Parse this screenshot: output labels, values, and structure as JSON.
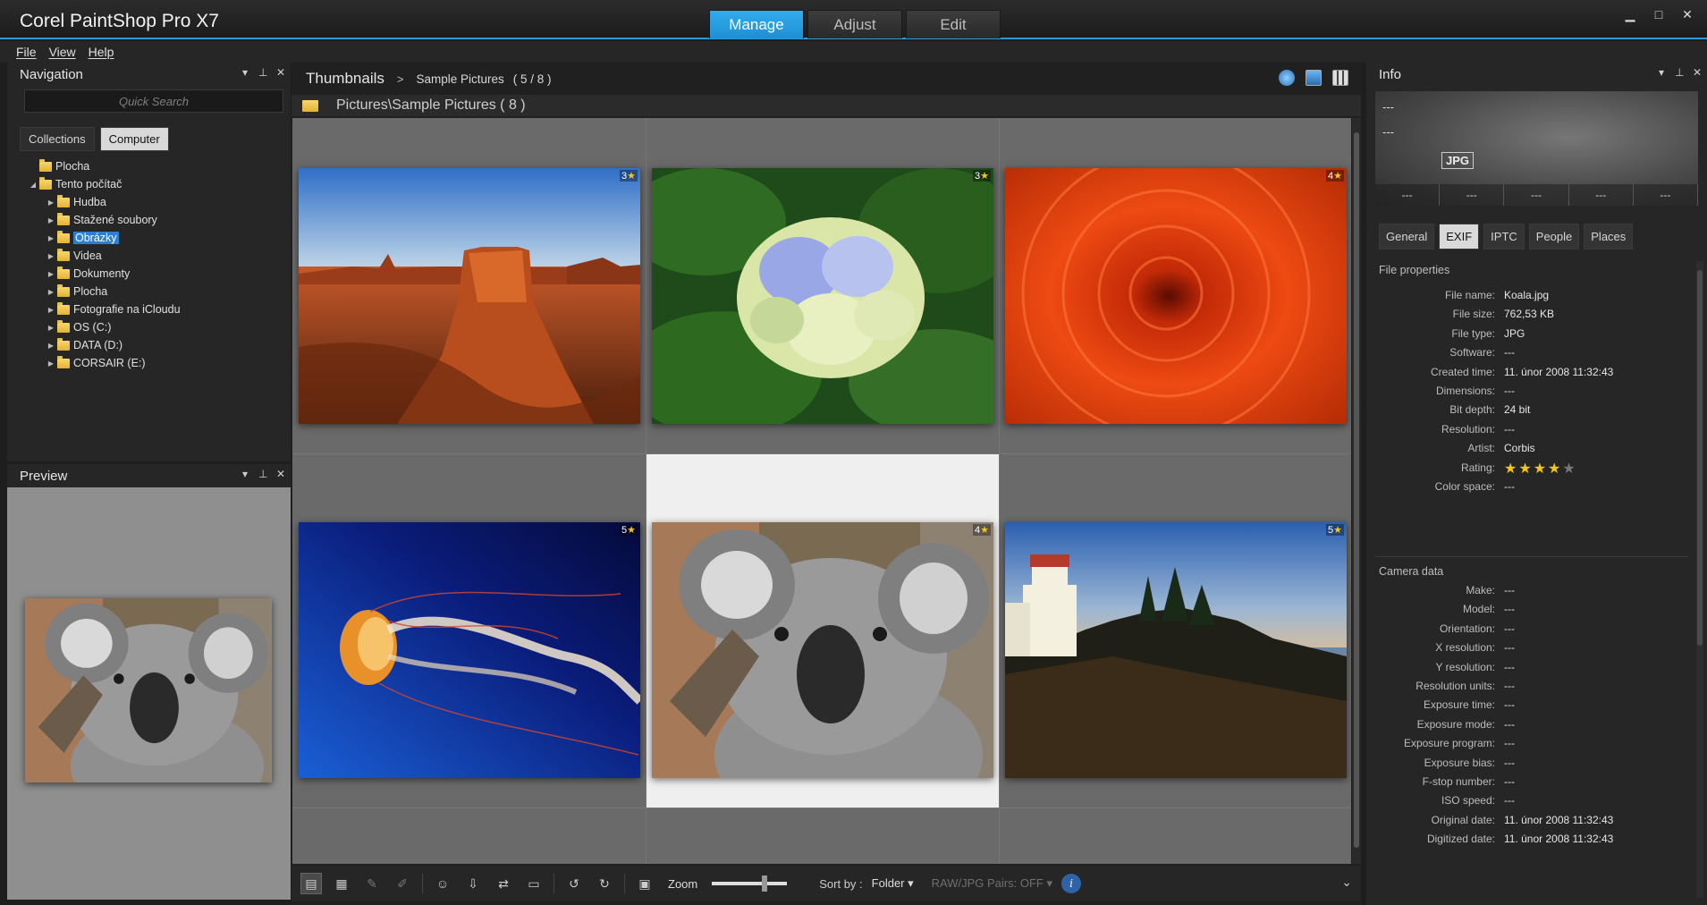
{
  "app": {
    "title": "Corel PaintShop Pro X7"
  },
  "mode_tabs": [
    {
      "label": "Manage",
      "active": true
    },
    {
      "label": "Adjust",
      "active": false
    },
    {
      "label": "Edit",
      "active": false
    }
  ],
  "window_controls": {
    "minimize": "▁",
    "maximize": "□",
    "close": "✕"
  },
  "menu": [
    "File",
    "View",
    "Help"
  ],
  "navigation": {
    "title": "Navigation",
    "search_placeholder": "Quick Search",
    "tabs": [
      {
        "label": "Collections",
        "active": false
      },
      {
        "label": "Computer",
        "active": true
      }
    ],
    "tree": [
      {
        "label": "Plocha",
        "level": 0,
        "arrow": ""
      },
      {
        "label": "Tento počítač",
        "level": 0,
        "arrow": "◢"
      },
      {
        "label": "Hudba",
        "level": 1,
        "arrow": "▶"
      },
      {
        "label": "Stažené soubory",
        "level": 1,
        "arrow": "▶"
      },
      {
        "label": "Obrázky",
        "level": 1,
        "arrow": "▶",
        "selected": true
      },
      {
        "label": "Videa",
        "level": 1,
        "arrow": "▶"
      },
      {
        "label": "Dokumenty",
        "level": 1,
        "arrow": "▶"
      },
      {
        "label": "Plocha",
        "level": 1,
        "arrow": "▶"
      },
      {
        "label": "Fotografie na iCloudu",
        "level": 1,
        "arrow": "▶"
      },
      {
        "label": "OS (C:)",
        "level": 1,
        "arrow": "▶"
      },
      {
        "label": "DATA (D:)",
        "level": 1,
        "arrow": "▶"
      },
      {
        "label": "CORSAIR (E:)",
        "level": 1,
        "arrow": "▶"
      }
    ]
  },
  "preview": {
    "title": "Preview"
  },
  "thumbnails": {
    "title": "Thumbnails",
    "crumb_sep": ">",
    "crumb": "Sample Pictures",
    "count": "( 5 / 8 )",
    "path": "Pictures\\Sample Pictures ( 8 )",
    "items": [
      {
        "name": "desert",
        "rating": "3"
      },
      {
        "name": "hydrangeas",
        "rating": "3"
      },
      {
        "name": "chrysanthemum",
        "rating": "4"
      },
      {
        "name": "jellyfish",
        "rating": "5"
      },
      {
        "name": "koala",
        "rating": "4",
        "selected": true
      },
      {
        "name": "lighthouse",
        "rating": "5"
      }
    ]
  },
  "toolbar": {
    "zoom_label": "Zoom",
    "zoom_level": 0.7,
    "sort_label": "Sort by :",
    "sort_value": "Folder ▾",
    "raw_pairs": "RAW/JPG Pairs: OFF ▾",
    "info_icon": "i"
  },
  "info": {
    "title": "Info",
    "histo_dash_1": "---",
    "histo_dash_2": "---",
    "format_badge": "JPG",
    "histo_cells": [
      "---",
      "---",
      "---",
      "---",
      "---"
    ],
    "tabs": [
      {
        "label": "General",
        "active": false
      },
      {
        "label": "EXIF",
        "active": true
      },
      {
        "label": "IPTC",
        "active": false
      },
      {
        "label": "People",
        "active": false
      },
      {
        "label": "Places",
        "active": false
      }
    ],
    "file_section": "File properties",
    "file_props": [
      {
        "key": "File name:",
        "value": "Koala.jpg"
      },
      {
        "key": "File size:",
        "value": "762,53 KB"
      },
      {
        "key": "File type:",
        "value": "JPG"
      },
      {
        "key": "Software:",
        "value": "---"
      },
      {
        "key": "Created time:",
        "value": "11. únor 2008 11:32:43"
      },
      {
        "key": "Dimensions:",
        "value": "---"
      },
      {
        "key": "Bit depth:",
        "value": "24 bit"
      },
      {
        "key": "Resolution:",
        "value": "---"
      },
      {
        "key": "Artist:",
        "value": "Corbis"
      },
      {
        "key": "Rating:",
        "value": "",
        "stars": 4,
        "stars_max": 5
      },
      {
        "key": "Color space:",
        "value": "---"
      }
    ],
    "camera_section": "Camera data",
    "camera_props": [
      {
        "key": "Make:",
        "value": "---"
      },
      {
        "key": "Model:",
        "value": "---"
      },
      {
        "key": "Orientation:",
        "value": "---"
      },
      {
        "key": "X resolution:",
        "value": "---"
      },
      {
        "key": "Y resolution:",
        "value": "---"
      },
      {
        "key": "Resolution units:",
        "value": "---"
      },
      {
        "key": "Exposure time:",
        "value": "---"
      },
      {
        "key": "Exposure mode:",
        "value": "---"
      },
      {
        "key": "Exposure program:",
        "value": "---"
      },
      {
        "key": "Exposure bias:",
        "value": "---"
      },
      {
        "key": "F-stop number:",
        "value": "---"
      },
      {
        "key": "ISO speed:",
        "value": "---"
      },
      {
        "key": "Original date:",
        "value": "11. únor 2008 11:32:43"
      },
      {
        "key": "Digitized date:",
        "value": "11. únor 2008 11:32:43"
      }
    ]
  }
}
